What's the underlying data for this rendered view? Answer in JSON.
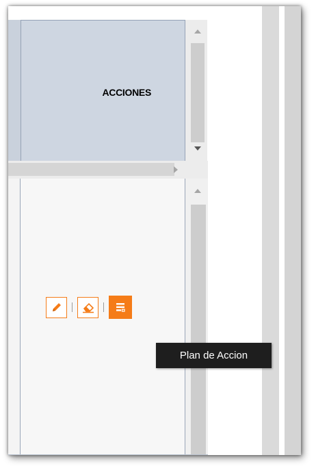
{
  "grid": {
    "header": {
      "column_title": "ACCIONES"
    }
  },
  "actions": {
    "edit_icon": "pencil-icon",
    "delete_icon": "eraser-icon",
    "plan_icon": "action-plan-icon"
  },
  "tooltip": {
    "text": "Plan de Accion"
  },
  "colors": {
    "accent": "#f57c18",
    "header_bg": "#ced6e1",
    "tooltip_bg": "#1e1e1e"
  }
}
